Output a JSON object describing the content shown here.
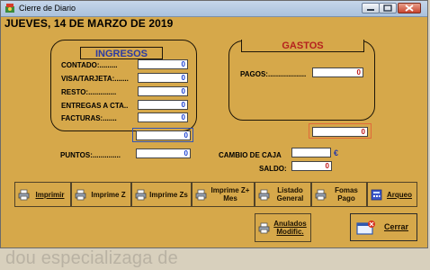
{
  "window": {
    "title": "Cierre de Diario"
  },
  "header": {
    "date": "JUEVES, 14 DE MARZO DE 2019"
  },
  "ingresos": {
    "title": "INGRESOS",
    "rows": [
      {
        "label": "CONTADO:.........",
        "value": "0"
      },
      {
        "label": "VISA/TARJETA:.......",
        "value": "0"
      },
      {
        "label": "RESTO:..............",
        "value": "0"
      },
      {
        "label": "ENTREGAS A CTA..",
        "value": "0"
      },
      {
        "label": "FACTURAS:.......",
        "value": "0"
      }
    ],
    "total": "0"
  },
  "gastos": {
    "title": "GASTOS",
    "pagos_label": "PAGOS:...................",
    "pagos_value": "0",
    "total": "0"
  },
  "puntos": {
    "label": "PUNTOS:..............",
    "value": "0"
  },
  "cambio_caja": {
    "label": "CAMBIO DE CAJA",
    "value": "",
    "currency": "€"
  },
  "saldo": {
    "label": "SALDO:",
    "value": "0"
  },
  "buttons": {
    "imprimir": "Imprimir",
    "imprime_z": "Imprime Z",
    "imprime_zs": "Imprime Zs",
    "imprime_z_mes": "Imprime Z+\nMes",
    "listado_general": "Listado\nGeneral",
    "formas_pago": "Fomas\nPago",
    "arqueo": "Arqueo",
    "anulados": "Anulados\nModific.",
    "cerrar": "Cerrar"
  },
  "background_text": "dou especializaga de"
}
